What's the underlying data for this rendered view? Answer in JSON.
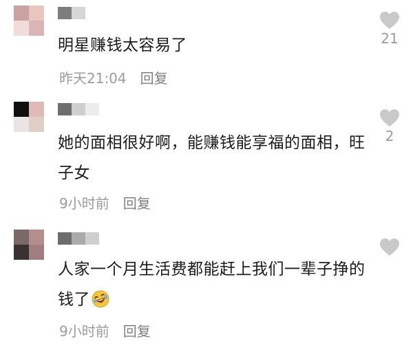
{
  "comments": [
    {
      "text": "明星赚钱太容易了",
      "time": "昨天21:04",
      "reply": "回复",
      "likes": "21",
      "avatar_colors": [
        "#c9a3a1",
        "#e8c6bd",
        "#f0dcd9",
        "#d9b5b8"
      ],
      "name_colors": [
        "#7d7d7d",
        "#d6d6d6"
      ]
    },
    {
      "text": "她的面相很好啊，能赚钱能享福的面相，旺子女",
      "time": "9小时前",
      "reply": "回复",
      "likes": "2",
      "avatar_colors": [
        "#101010",
        "#e0b9b9",
        "#eae4e4",
        "#e0cfc6"
      ],
      "name_colors": [
        "#6e6e6e",
        "#cfcfcf",
        "#ececec"
      ]
    },
    {
      "text": "人家一个月生活费都能赶上我们一辈子挣的钱了",
      "time": "9小时前",
      "reply": "回复",
      "likes": "",
      "avatar_colors": [
        "#7b6868",
        "#b38e8c",
        "#3a3232",
        "#a07e80"
      ],
      "name_colors": [
        "#6c6c6c",
        "#aaaaaa",
        "#cfcfcf"
      ]
    }
  ],
  "icons": {
    "like": "heart-icon",
    "emoji": "rofl-emoji-icon"
  },
  "colors": {
    "heart": "#c9c9c9",
    "meta_text": "#9b9b9b",
    "body_text": "#1c1c1c"
  }
}
